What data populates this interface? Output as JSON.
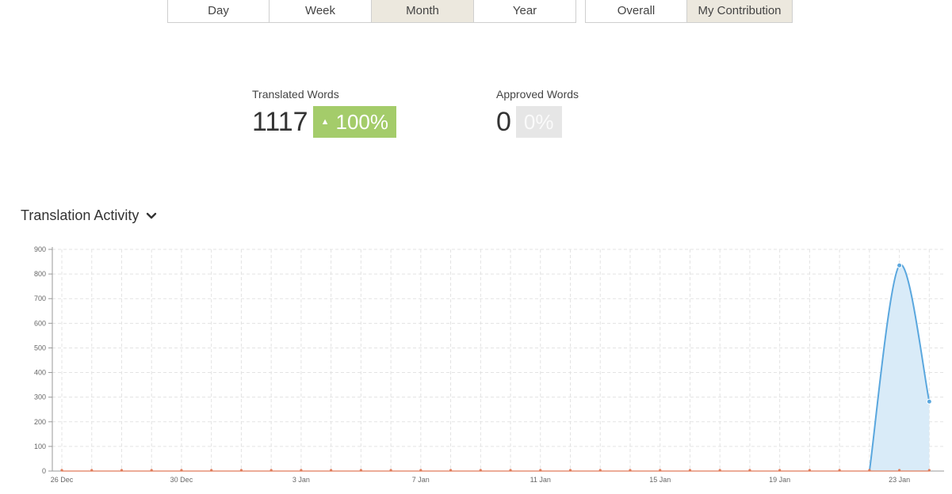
{
  "period_buttons": [
    {
      "label": "Day",
      "active": false
    },
    {
      "label": "Week",
      "active": false
    },
    {
      "label": "Month",
      "active": true
    },
    {
      "label": "Year",
      "active": false
    }
  ],
  "scope_buttons": [
    {
      "label": "Overall",
      "active": false
    },
    {
      "label": "My Contribution",
      "active": true
    }
  ],
  "stats": {
    "translated": {
      "label": "Translated Words",
      "value": "1117",
      "change": "100%",
      "arrow": "▲"
    },
    "approved": {
      "label": "Approved Words",
      "value": "0",
      "change": "0%"
    }
  },
  "activity": {
    "title": "Translation Activity"
  },
  "chart_data": {
    "type": "area",
    "x_dates": [
      "26 Dec",
      "27 Dec",
      "28 Dec",
      "29 Dec",
      "30 Dec",
      "31 Dec",
      "1 Jan",
      "2 Jan",
      "3 Jan",
      "4 Jan",
      "5 Jan",
      "6 Jan",
      "7 Jan",
      "8 Jan",
      "9 Jan",
      "10 Jan",
      "11 Jan",
      "12 Jan",
      "13 Jan",
      "14 Jan",
      "15 Jan",
      "16 Jan",
      "17 Jan",
      "18 Jan",
      "19 Jan",
      "20 Jan",
      "21 Jan",
      "22 Jan",
      "23 Jan",
      "24 Jan"
    ],
    "x_tick_labels": [
      "26 Dec",
      "30 Dec",
      "3 Jan",
      "7 Jan",
      "11 Jan",
      "15 Jan",
      "19 Jan",
      "23 Jan"
    ],
    "series": [
      {
        "values": [
          0,
          0,
          0,
          0,
          0,
          0,
          0,
          0,
          0,
          0,
          0,
          0,
          0,
          0,
          0,
          0,
          0,
          0,
          0,
          0,
          0,
          0,
          0,
          0,
          0,
          0,
          0,
          0,
          835,
          282
        ],
        "color": "#5aa7de"
      },
      {
        "values": [
          0,
          0,
          0,
          0,
          0,
          0,
          0,
          0,
          0,
          0,
          0,
          0,
          0,
          0,
          0,
          0,
          0,
          0,
          0,
          0,
          0,
          0,
          0,
          0,
          0,
          0,
          0,
          0,
          0,
          0
        ],
        "color": "#e07b5a"
      }
    ],
    "ylim": [
      0,
      900
    ],
    "y_ticks": [
      0,
      100,
      200,
      300,
      400,
      500,
      600,
      700,
      800,
      900
    ],
    "grid": true,
    "fill_color": "#d9ebf8",
    "xlabel": "",
    "ylabel": ""
  }
}
